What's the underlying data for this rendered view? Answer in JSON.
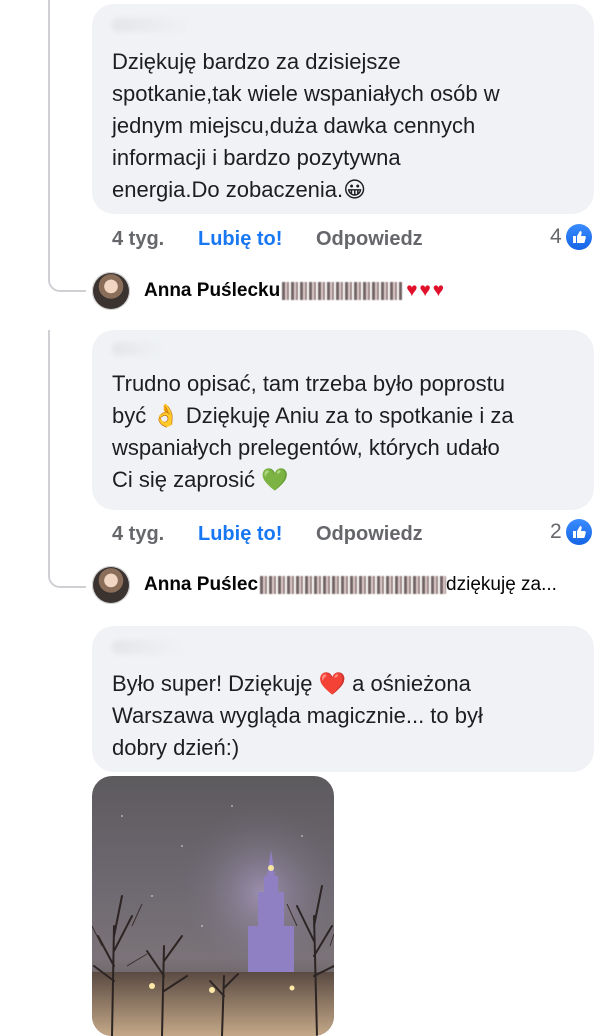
{
  "comments": [
    {
      "text": "Dziękuję bardzo za dzisiejsze\nspotkanie,tak wiele wspaniałych osób w\njednym miejscu,duża dawka cennych\ninformacji i bardzo pozytywna\nenergia.Do zobaczenia.😀",
      "time": "4 tyg.",
      "like_label": "Lubię to!",
      "reply_label": "Odpowiedz",
      "reactions": "4",
      "reply": {
        "name": "Anna Puślecku",
        "hearts": "♥♥♥"
      }
    },
    {
      "text": "Trudno opisać, tam trzeba było poprostu\nbyć 👌 Dziękuję Aniu za to spotkanie i za\nwspaniałych prelegentów, których udało\nCi się zaprosić 💚",
      "time": "4 tyg.",
      "like_label": "Lubię to!",
      "reply_label": "Odpowiedz",
      "reactions": "2",
      "reply": {
        "name": "Anna Puślec",
        "snippet": "dziękuję za..."
      }
    },
    {
      "text": "Było super! Dziękuję ❤️ a ośnieżona\nWarszawa wygląda magicznie... to był\ndobry dzień:)",
      "photo": "snowy-warsaw-palace-of-culture-photo"
    }
  ],
  "icons": {
    "like_badge": "thumbs-up-icon",
    "avatar": "user-avatar"
  },
  "colors": {
    "bubble": "#f0f2f5",
    "link_blue": "#1877f2",
    "muted": "#65676b",
    "heart": "#e0102a"
  }
}
